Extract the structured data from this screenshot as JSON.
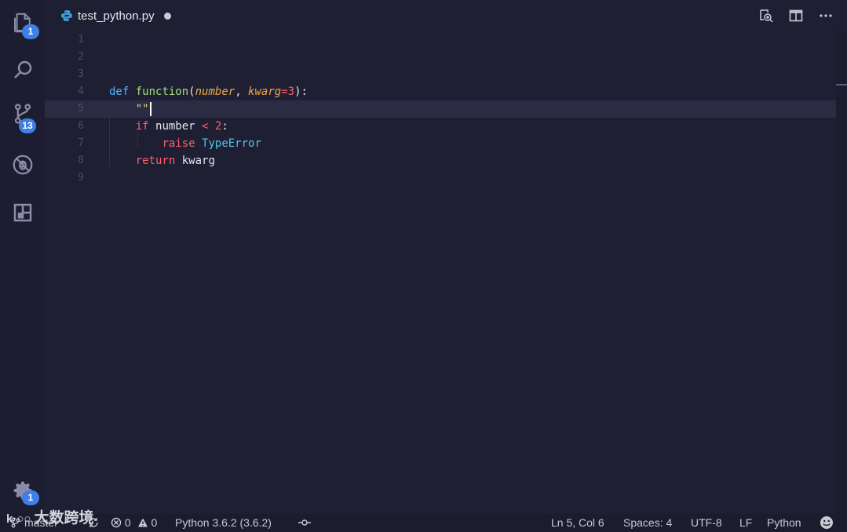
{
  "activity_bar": {
    "explorer_badge": "1",
    "source_control_badge": "13",
    "settings_badge": "1"
  },
  "tab": {
    "title": "test_python.py"
  },
  "editor": {
    "line_numbers": [
      "1",
      "2",
      "3",
      "4",
      "5",
      "6",
      "7",
      "8",
      "9"
    ],
    "current_line": 5,
    "code": {
      "l4_def": "def",
      "l4_fn": "function",
      "l4_p1": "number",
      "l4_p2": "kwarg",
      "l4_default": "3",
      "l5_text": "\"\"",
      "l6_if": "if",
      "l6_var": "number",
      "l6_op": "<",
      "l6_num": "2",
      "l7_raise": "raise",
      "l7_cls": "TypeError",
      "l8_return": "return",
      "l8_var": "kwarg"
    }
  },
  "status_bar": {
    "branch": "master",
    "errors": "0",
    "warnings": "0",
    "interpreter": "Python 3.6.2 (3.6.2)",
    "position": "Ln 5, Col 6",
    "spaces": "Spaces: 4",
    "encoding": "UTF-8",
    "eol": "LF",
    "language": "Python"
  },
  "watermark": {
    "text": "大数跨境"
  },
  "colors": {
    "background": "#1e1f33",
    "badge": "#3f7fe8",
    "keyword_def": "#56b6ff",
    "function_name": "#a5e07a",
    "parameter": "#f0a845",
    "keyword_control": "#ff5f6d",
    "class_name": "#4fc6e8"
  }
}
